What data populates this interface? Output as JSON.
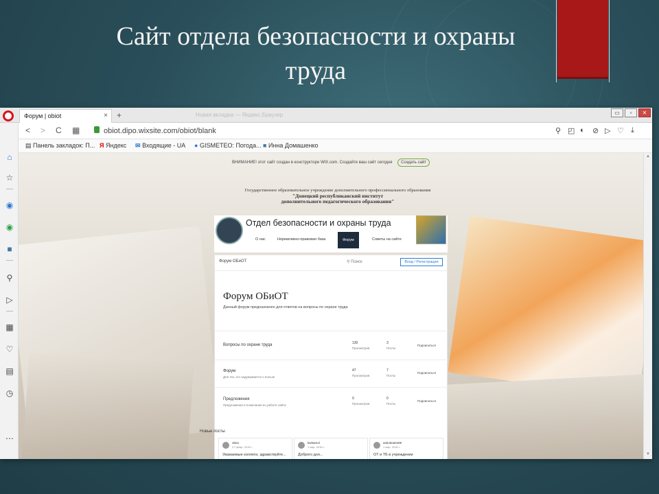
{
  "slide": {
    "title_line1": "Сайт отдела безопасности и охраны",
    "title_line2": "труда"
  },
  "browser": {
    "tab_title": "Форум | obiot",
    "tab_close": "×",
    "tab_add": "+",
    "ghost_tab": "Новая вкладка — Яндекс.Браузер",
    "url": "obiot.dipo.wixsite.com/obiot/blank",
    "window_buttons": [
      "▭",
      "▫",
      "✕"
    ],
    "bookmarks": [
      {
        "icon": "list-icon",
        "label": "Панель закладок: П..."
      },
      {
        "icon": "yandex-icon",
        "label": "Яндекс"
      },
      {
        "icon": "mail-icon",
        "label": "Входящие - UA"
      },
      {
        "icon": "weather-icon",
        "label": "GISMETEO: Погода..."
      },
      {
        "icon": "vk-icon",
        "label": "Инна Домашенко"
      }
    ],
    "sidebar_icons": [
      "home-icon",
      "star-icon",
      "messenger-icon",
      "whatsapp-icon",
      "vk-icon",
      "search-icon",
      "send-icon",
      "grid-icon",
      "heart-icon",
      "news-icon",
      "clock-icon",
      "more-icon"
    ]
  },
  "wix_bar": {
    "text": "ВНИМАНИЕ! этот сайт создан в конструкторе WIX.com. Создайте ваш сайт сегодня",
    "button": "Создать сайт"
  },
  "site": {
    "org_line1": "Государственное образовательное учреждение дополнительного профессионального образования",
    "org_line2": "\"Донецкий республиканский институт",
    "org_line3": "дополнительного педагогического образования\"",
    "title": "Отдел безопасности и охраны труда",
    "nav": [
      "О нас",
      "Нормативно-правовая база",
      "Форум",
      "Советы на сайте"
    ],
    "active_nav": "Форум"
  },
  "forum": {
    "crumb": "Форум ОБиОТ",
    "search": "Поиск",
    "login": "Вход / Регистрация",
    "title": "Форум ОБиОТ",
    "description": "Данный форум предназначен для ответов на вопросы по охране труда",
    "categories": [
      {
        "name": "Вопросы по охране труда",
        "sub": "",
        "views": "130",
        "views_label": "Просмотров",
        "posts": "3",
        "posts_label": "Посты",
        "action": "Подписаться"
      },
      {
        "name": "Форум",
        "sub": "Для тех, кто задумывается о пользе",
        "views": "47",
        "views_label": "Просмотров",
        "posts": "7",
        "posts_label": "Посты",
        "action": "Подписаться"
      },
      {
        "name": "Предложения",
        "sub": "Предложения и пожелания по работе сайта",
        "views": "0",
        "views_label": "Просмотров",
        "posts": "0",
        "posts_label": "Посты",
        "action": "Подписаться"
      }
    ],
    "new_posts_title": "Новые посты",
    "posts": [
      {
        "author": "obiot",
        "date": "27 февр. 2018 г.",
        "text": "Уважаемые коллеги, здравствуйте..."
      },
      {
        "author": "lavkamol",
        "date": "1 мар. 2018 г.",
        "text": "Доброго дня..."
      },
      {
        "author": "antiukraine08",
        "date": "1 мар. 2018 г.",
        "text": "ОТ и ТБ в учреждении"
      }
    ]
  }
}
